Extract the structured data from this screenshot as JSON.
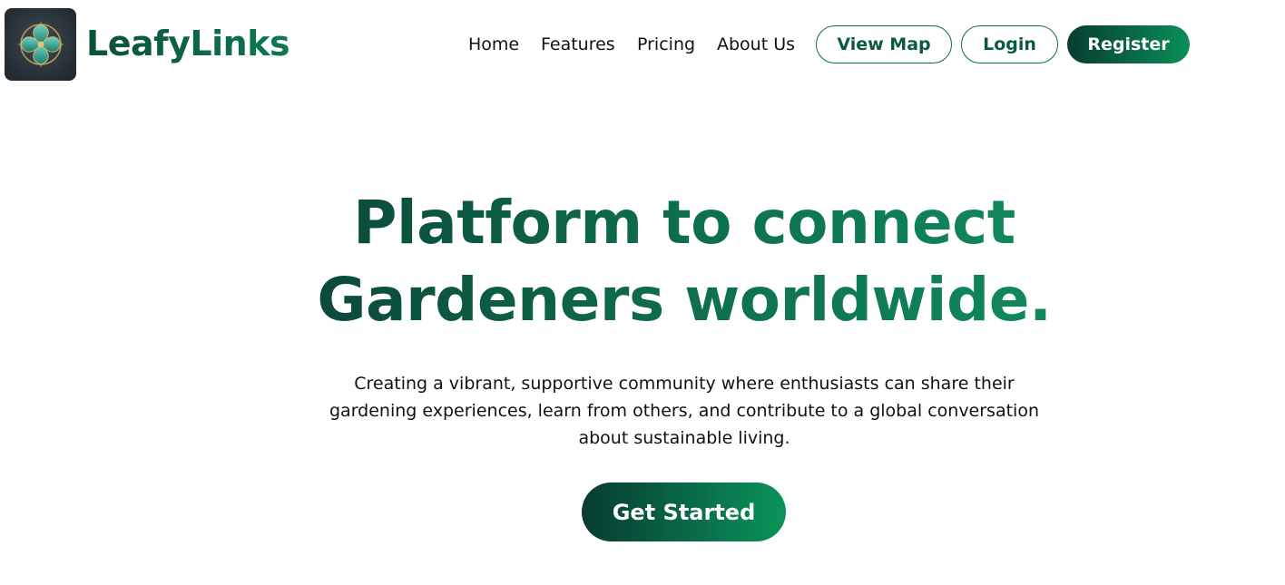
{
  "brand": {
    "name": "LeafyLinks",
    "logo_icon": "leaf-compass-icon"
  },
  "nav": {
    "links": [
      "Home",
      "Features",
      "Pricing",
      "About Us"
    ],
    "view_map": "View Map",
    "login": "Login",
    "register": "Register"
  },
  "hero": {
    "title": "Platform to connect Gardeners worldwide.",
    "subtitle": "Creating a vibrant, supportive community where enthusiasts can share their gardening experiences, learn from others, and contribute to a global conversation about sustainable living.",
    "cta": "Get Started"
  },
  "colors": {
    "brand_dark": "#083c32",
    "brand_green": "#0a8f57",
    "text": "#111111",
    "background": "#ffffff"
  }
}
